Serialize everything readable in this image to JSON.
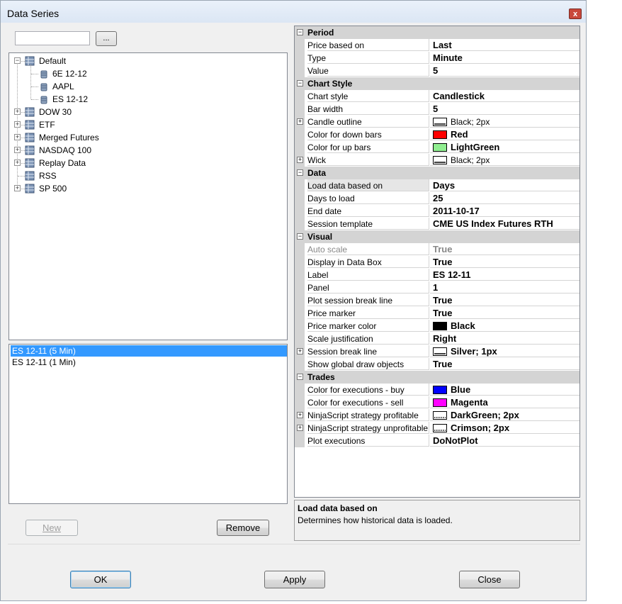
{
  "window": {
    "title": "Data Series",
    "close_glyph": "x"
  },
  "filter": {
    "value": "",
    "browse_label": "..."
  },
  "tree": {
    "items": [
      {
        "label": "Default",
        "expanded": true,
        "children": [
          "6E 12-12",
          "AAPL",
          "ES 12-12"
        ]
      },
      {
        "label": "DOW 30",
        "expanded": false
      },
      {
        "label": "ETF",
        "expanded": false
      },
      {
        "label": "Merged Futures",
        "expanded": false
      },
      {
        "label": "NASDAQ 100",
        "expanded": false
      },
      {
        "label": "Replay Data",
        "expanded": false
      },
      {
        "label": "RSS",
        "expanded": null
      },
      {
        "label": "SP 500",
        "expanded": false
      }
    ]
  },
  "series_list": {
    "items": [
      "ES 12-11 (5 Min)",
      "ES 12-11 (1 Min)"
    ],
    "selected_index": 0
  },
  "buttons": {
    "new": "New",
    "remove": "Remove",
    "ok": "OK",
    "apply": "Apply",
    "close": "Close"
  },
  "grid": {
    "rows": [
      {
        "kind": "category",
        "label": "Period"
      },
      {
        "kind": "prop",
        "name": "Price based on",
        "value": "Last"
      },
      {
        "kind": "prop",
        "name": "Type",
        "value": "Minute"
      },
      {
        "kind": "prop",
        "name": "Value",
        "value": "5"
      },
      {
        "kind": "category",
        "label": "Chart Style"
      },
      {
        "kind": "prop",
        "name": "Chart style",
        "value": "Candlestick"
      },
      {
        "kind": "prop",
        "name": "Bar width",
        "value": "5"
      },
      {
        "kind": "prop",
        "name": "Candle outline",
        "value": "Black; 2px",
        "expandable": true,
        "swatch": "line-solid",
        "plain": true
      },
      {
        "kind": "prop",
        "name": "Color for down bars",
        "value": "Red",
        "swatch": "#ff0000"
      },
      {
        "kind": "prop",
        "name": "Color for up bars",
        "value": "LightGreen",
        "swatch": "#90ee90"
      },
      {
        "kind": "prop",
        "name": "Wick",
        "value": "Black; 2px",
        "expandable": true,
        "swatch": "line-solid",
        "plain": true
      },
      {
        "kind": "category",
        "label": "Data"
      },
      {
        "kind": "prop",
        "name": "Load data based on",
        "value": "Days",
        "selected": true
      },
      {
        "kind": "prop",
        "name": "Days to load",
        "value": "25"
      },
      {
        "kind": "prop",
        "name": "End date",
        "value": "2011-10-17"
      },
      {
        "kind": "prop",
        "name": "Session template",
        "value": "CME US Index Futures RTH"
      },
      {
        "kind": "category",
        "label": "Visual"
      },
      {
        "kind": "prop",
        "name": "Auto scale",
        "value": "True",
        "disabled": true
      },
      {
        "kind": "prop",
        "name": "Display in Data Box",
        "value": "True"
      },
      {
        "kind": "prop",
        "name": "Label",
        "value": "ES 12-11"
      },
      {
        "kind": "prop",
        "name": "Panel",
        "value": "1"
      },
      {
        "kind": "prop",
        "name": "Plot session break line",
        "value": "True"
      },
      {
        "kind": "prop",
        "name": "Price marker",
        "value": "True"
      },
      {
        "kind": "prop",
        "name": "Price marker color",
        "value": "Black",
        "swatch": "#000000"
      },
      {
        "kind": "prop",
        "name": "Scale justification",
        "value": "Right"
      },
      {
        "kind": "prop",
        "name": "Session break line",
        "value": "Silver; 1px",
        "expandable": true,
        "swatch": "line-solid"
      },
      {
        "kind": "prop",
        "name": "Show global draw objects",
        "value": "True"
      },
      {
        "kind": "category",
        "label": "Trades"
      },
      {
        "kind": "prop",
        "name": "Color for executions - buy",
        "value": "Blue",
        "swatch": "#0000ff"
      },
      {
        "kind": "prop",
        "name": "Color for executions - sell",
        "value": "Magenta",
        "swatch": "#ff00ff"
      },
      {
        "kind": "prop",
        "name": "NinjaScript strategy profitable",
        "value": "DarkGreen; 2px",
        "expandable": true,
        "swatch": "line-dotted"
      },
      {
        "kind": "prop",
        "name": "NinjaScript strategy unprofitable",
        "value": "Crimson; 2px",
        "expandable": true,
        "swatch": "line-dotted"
      },
      {
        "kind": "prop",
        "name": "Plot executions",
        "value": "DoNotPlot"
      }
    ]
  },
  "description": {
    "title": "Load data based on",
    "text": "Determines how historical data is loaded."
  }
}
